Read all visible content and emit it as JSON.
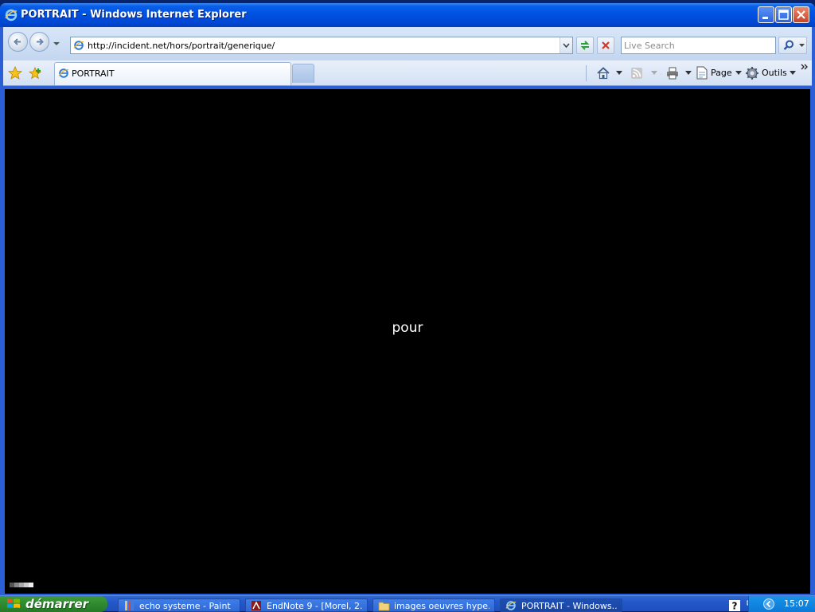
{
  "window": {
    "title": "PORTRAIT - Windows Internet Explorer"
  },
  "address_bar": {
    "url": "http://incident.net/hors/portrait/generique/",
    "search_placeholder": "Live Search"
  },
  "tabs": [
    {
      "label": "PORTRAIT",
      "active": true
    }
  ],
  "command_bar": {
    "page_label": "Page",
    "tools_label": "Outils"
  },
  "content": {
    "word": "pour"
  },
  "taskbar": {
    "start_label": "démarrer",
    "tasks": [
      {
        "label": "echo systeme - Paint",
        "icon": "paint-icon",
        "active": false
      },
      {
        "label": "EndNote 9 - [Morel, 2...",
        "icon": "endnote-icon",
        "active": false
      },
      {
        "label": "images oeuvres hype...",
        "icon": "folder-icon",
        "active": false
      },
      {
        "label": "PORTRAIT - Windows...",
        "icon": "ie-icon",
        "active": true
      }
    ],
    "clock": "15:07"
  }
}
